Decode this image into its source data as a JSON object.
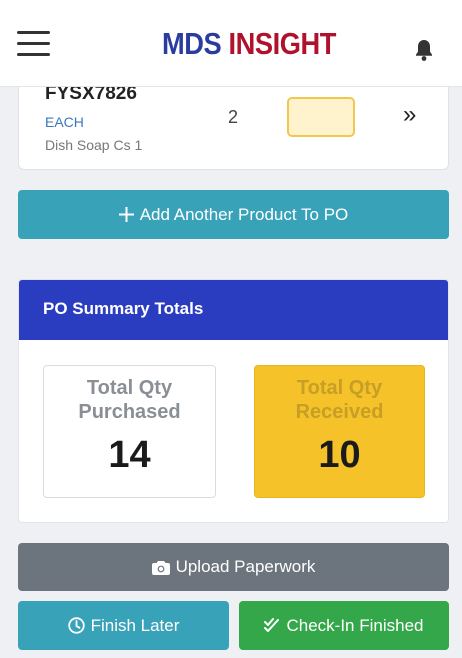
{
  "header": {
    "logo_part1": "MDS",
    "logo_part2": "INSIGHT",
    "brand_blue": "#2a3d9e",
    "brand_red": "#b0122e",
    "menu_icon": "hamburger-icon",
    "notification_icon": "bell-icon"
  },
  "product": {
    "sku": "FYSX7826",
    "uom": "EACH",
    "description": "Dish Soap Cs 1",
    "qty_ordered": "2",
    "qty_received_value": "",
    "next_icon": "double-chevron-right-icon"
  },
  "actions": {
    "add_product_label": "Add Another Product To PO",
    "upload_label": "Upload Paperwork",
    "finish_later_label": "Finish Later",
    "checkin_finished_label": "Check-In Finished"
  },
  "summary": {
    "title": "PO Summary Totals",
    "purchased_label": "Total Qty Purchased",
    "purchased_value": "14",
    "received_label": "Total Qty Received",
    "received_value": "10",
    "header_color": "#2a3cc0",
    "received_color": "#f5c22a"
  }
}
